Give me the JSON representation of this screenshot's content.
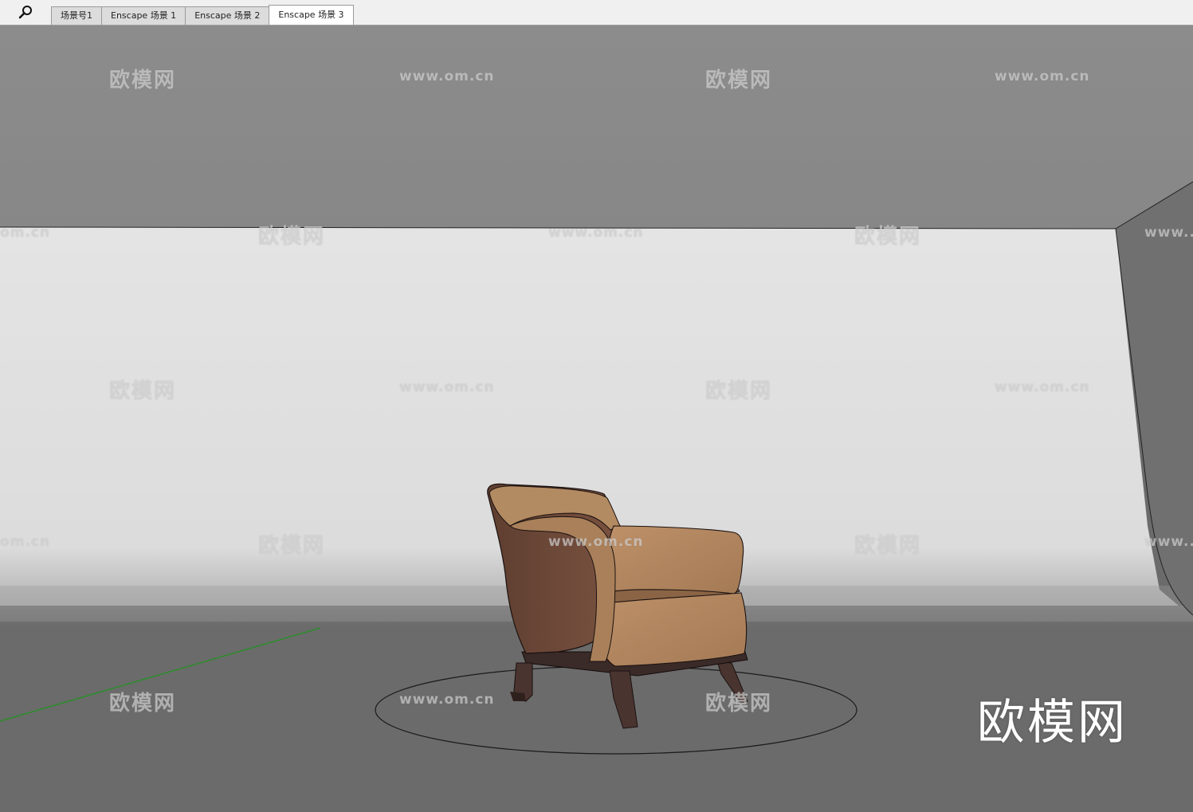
{
  "toolbar": {
    "search_icon": "search-icon"
  },
  "tabs": [
    {
      "label": "场景号1",
      "active": false
    },
    {
      "label": "Enscape 场景 1",
      "active": false
    },
    {
      "label": "Enscape 场景 2",
      "active": false
    },
    {
      "label": "Enscape 场景 3",
      "active": true
    }
  ],
  "watermarks": {
    "cn_text": "欧模网",
    "url_text": "www.om.cn",
    "partial_url_left": "om.cn",
    "partial_url_right": "www.."
  },
  "brand_logo": {
    "text": "欧模网"
  },
  "colors": {
    "ceiling": "#8a8a8a",
    "wall": "#e2e2e2",
    "floor": "#6b6b6b",
    "side_wall": "#737373",
    "chair_leather": "#b08660",
    "chair_back": "#6e4a38",
    "chair_legs": "#4a3430",
    "axis_green": "#2e8b2e"
  }
}
